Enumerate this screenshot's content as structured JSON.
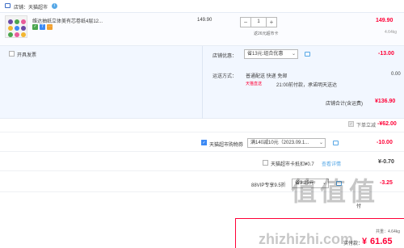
{
  "store": {
    "label": "店铺：天猫超市",
    "info_icon": "i"
  },
  "item": {
    "title": "维达抽纸立体美有芯卷纸4层12...",
    "unit_price": "149.90",
    "quantity": "1",
    "decrement": "−",
    "increment": "+",
    "delivery_note": "返26元超市卡",
    "subtotal": "149.90",
    "weight": "4.64kg",
    "tags": [
      "✓",
      "7",
      "⋯"
    ]
  },
  "invoice": {
    "label": "开具发票"
  },
  "promotion": {
    "label": "店铺优惠：",
    "selected": "省13元:组合优惠",
    "amount": "-13.00"
  },
  "shipping": {
    "label": "运送方式：",
    "method": "普通配送 快递 免邮",
    "amount": "0.00",
    "badge": "天猫直送",
    "time_note": "21:00前付款，承诺明天送达"
  },
  "store_total": {
    "label": "店铺合计(含运费)",
    "amount": "¥136.90"
  },
  "order_discount": {
    "label": "下单立减",
    "amount": "-¥62.00"
  },
  "coupon": {
    "label": "天猫超市购物券",
    "selected": "满140减10元（2023.09.1...",
    "amount": "-10.00"
  },
  "card": {
    "label": "天猫超市卡抵扣¥0.7",
    "link": "查看详情",
    "amount": "¥-0.70"
  },
  "vip": {
    "label": "88VIP专享9.5折",
    "selected": "省3.25元",
    "amount": "-3.25"
  },
  "footer": {
    "hint": "付",
    "weight_label": "共重：4.64kg",
    "pay_label": "实付款：",
    "currency": "¥",
    "total": "61.65"
  },
  "watermark": {
    "text": "值值值",
    "url": "zhizhizhi.com"
  },
  "colors": {
    "accent": "#ff0036",
    "brand_blue": "#3c8af5"
  }
}
